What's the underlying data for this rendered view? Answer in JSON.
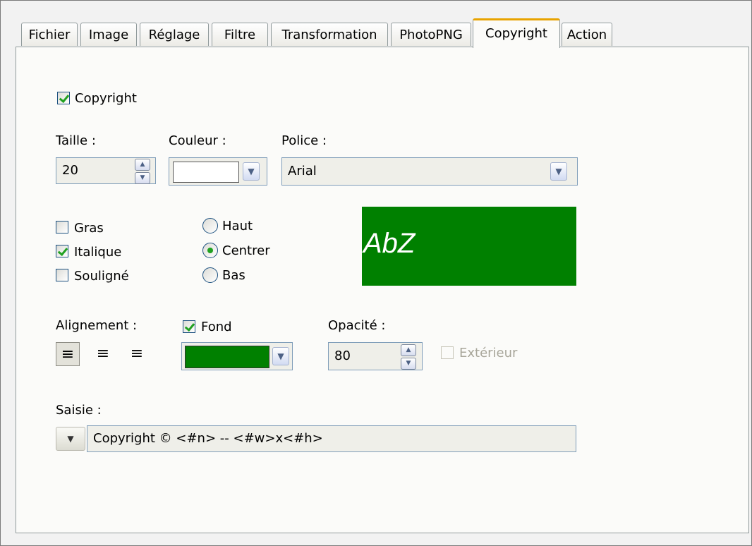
{
  "tabs": [
    "Fichier",
    "Image",
    "Réglage",
    "Filtre",
    "Transformation",
    "PhotoPNG",
    "Copyright",
    "Action"
  ],
  "active_tab": "Copyright",
  "copyright_checkbox": {
    "label": "Copyright",
    "checked": true
  },
  "taille": {
    "label": "Taille :",
    "value": "20"
  },
  "couleur": {
    "label": "Couleur :",
    "swatch": "#ffffff"
  },
  "police": {
    "label": "Police :",
    "value": "Arial"
  },
  "styles": [
    {
      "label": "Gras",
      "checked": false
    },
    {
      "label": "Italique",
      "checked": true
    },
    {
      "label": "Souligné",
      "checked": false
    }
  ],
  "position": [
    {
      "label": "Haut",
      "selected": false
    },
    {
      "label": "Centrer",
      "selected": true
    },
    {
      "label": "Bas",
      "selected": false
    }
  ],
  "preview": {
    "text": "AbZ",
    "background": "#008000",
    "color": "#ffffff"
  },
  "alignement": {
    "label": "Alignement :",
    "options": [
      "left",
      "center",
      "right"
    ],
    "selected": "left"
  },
  "fond": {
    "label": "Fond",
    "checked": true,
    "color": "#008000"
  },
  "opacite": {
    "label": "Opacité :",
    "value": "80"
  },
  "exterieur": {
    "label": "Extérieur",
    "checked": false,
    "enabled": false
  },
  "saisie": {
    "label": "Saisie :",
    "value": "Copyright © <#n> -- <#w>x<#h>"
  },
  "icons": {
    "spin": "up-down-arrows-icon",
    "dropdown": "chevron-down-icon",
    "align": [
      "align-left-icon",
      "align-center-icon",
      "align-right-icon"
    ]
  }
}
